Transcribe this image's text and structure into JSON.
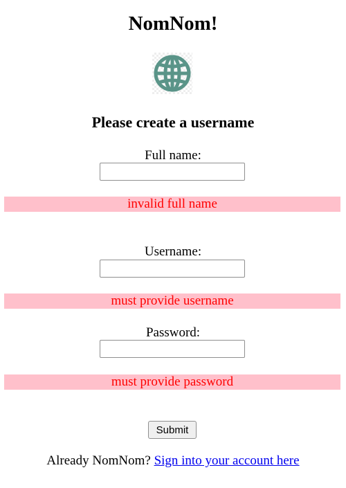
{
  "app": {
    "title": "NomNom!",
    "logo_icon": "globe-icon",
    "logo_color": "#5a9488"
  },
  "form": {
    "heading": "Please create a username",
    "full_name": {
      "label": "Full name:",
      "value": "",
      "error": "invalid full name"
    },
    "username": {
      "label": "Username:",
      "value": "",
      "error": "must provide username"
    },
    "password": {
      "label": "Password:",
      "value": "",
      "error": "must provide password"
    },
    "submit_label": "Submit"
  },
  "footer": {
    "prompt": "Already NomNom?",
    "link_text": "Sign into your account here"
  },
  "colors": {
    "error_background": "#ffc0cb",
    "error_text": "#ff0000",
    "link": "#0000ee"
  }
}
